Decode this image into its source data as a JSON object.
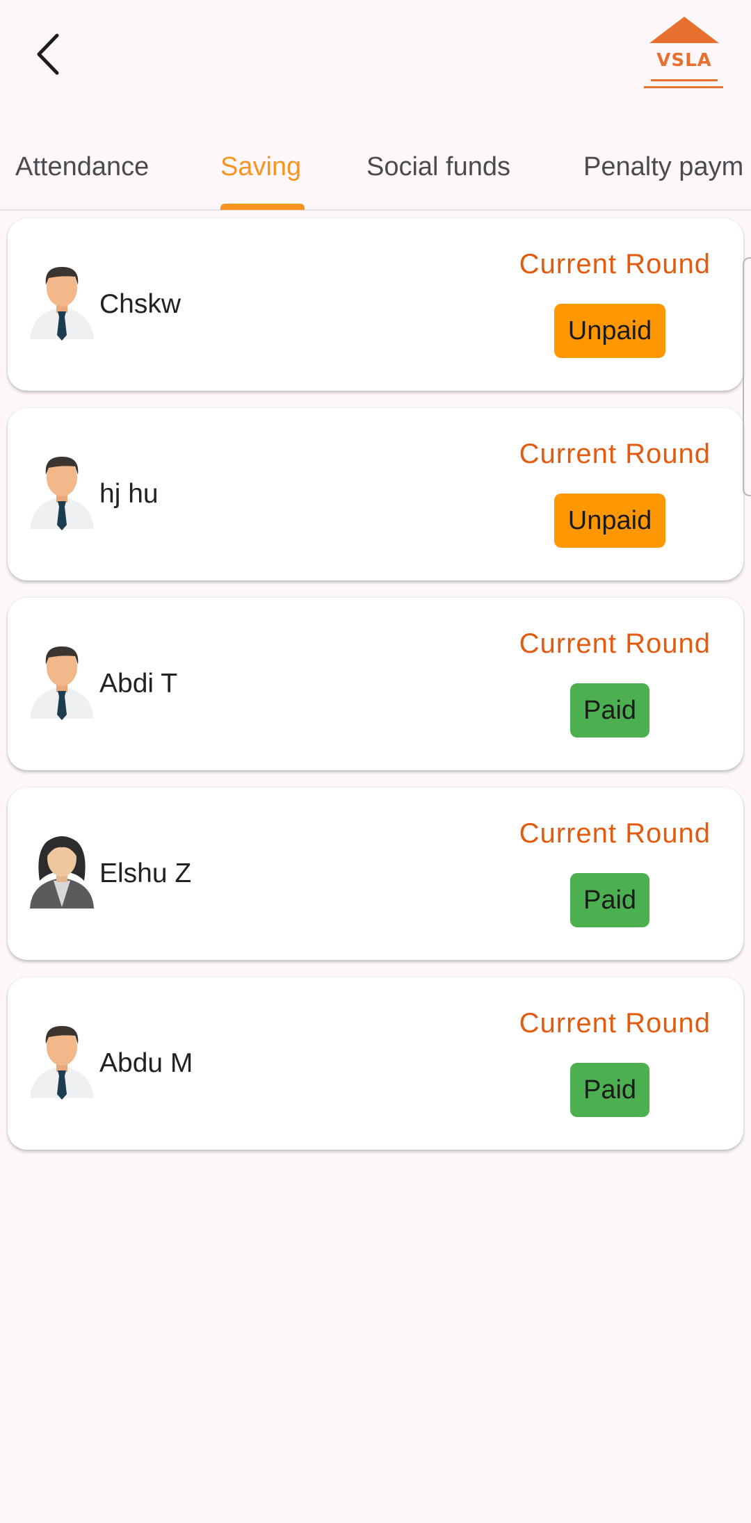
{
  "header": {
    "back_icon": "chevron-left-icon",
    "logo_text": "VSLA",
    "brand_color": "#e8702e"
  },
  "tabs": [
    {
      "label": "Attendance",
      "active": false
    },
    {
      "label": "Saving",
      "active": true
    },
    {
      "label": "Social funds",
      "active": false
    },
    {
      "label": "Penalty paym",
      "active": false
    }
  ],
  "members": [
    {
      "name": "Chskw",
      "round_label": "Current Round",
      "status": "Unpaid",
      "avatar": "male-avatar-icon"
    },
    {
      "name": "hj hu",
      "round_label": "Current Round",
      "status": "Unpaid",
      "avatar": "male-avatar-icon"
    },
    {
      "name": "Abdi T",
      "round_label": "Current Round",
      "status": "Paid",
      "avatar": "male-avatar-icon"
    },
    {
      "name": "Elshu Z",
      "round_label": "Current Round",
      "status": "Paid",
      "avatar": "female-avatar-icon"
    },
    {
      "name": "Abdu M",
      "round_label": "Current Round",
      "status": "Paid",
      "avatar": "male-avatar-icon"
    }
  ],
  "colors": {
    "active_tab": "#f7941d",
    "round_label": "#e25b0f",
    "unpaid": "#ff9800",
    "paid": "#4caf50"
  }
}
